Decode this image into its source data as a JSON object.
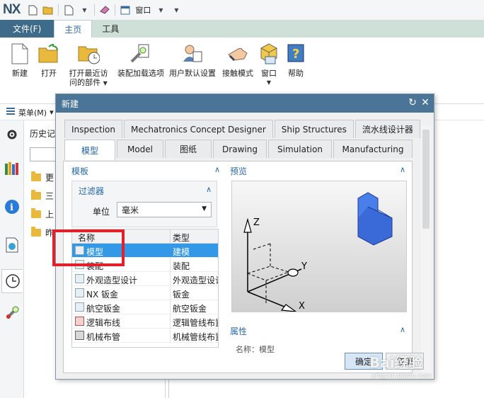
{
  "app": {
    "logo": "NX",
    "window_menu": "窗口"
  },
  "ribbon_tabs": [
    "文件(F)",
    "主页",
    "工具"
  ],
  "ribbon_buttons": [
    {
      "label": "新建",
      "label2": ""
    },
    {
      "label": "打开",
      "label2": ""
    },
    {
      "label": "打开最近访",
      "label2": "问的部件"
    },
    {
      "label": "装配加载选项",
      "label2": ""
    },
    {
      "label": "用户默认设置",
      "label2": ""
    },
    {
      "label": "接触模式",
      "label2": ""
    },
    {
      "label": "窗口",
      "label2": ""
    },
    {
      "label": "帮助",
      "label2": ""
    }
  ],
  "menu": {
    "label": "菜单(M)"
  },
  "history": {
    "title": "历史记",
    "folders": [
      "更",
      "三",
      "上",
      "昨"
    ]
  },
  "dialog": {
    "title": "新建",
    "tabs_row1": [
      "Inspection",
      "Mechatronics Concept Designer",
      "Ship Structures",
      "流水线设计器"
    ],
    "tabs_row2": [
      "模型",
      "Model",
      "图纸",
      "Drawing",
      "Simulation",
      "Manufacturing"
    ],
    "template_section": "模板",
    "filter_section": "过滤器",
    "unit_label": "单位",
    "unit_value": "毫米",
    "preview_section": "预览",
    "properties_section": "属性",
    "properties_partial": "名称：模型",
    "list_headers": {
      "name": "名称",
      "type": "类型"
    },
    "templates": [
      {
        "name": "模型",
        "type": "建模",
        "selected": true
      },
      {
        "name": "装配",
        "type": "装配",
        "selected": false
      },
      {
        "name": "外观造型设计",
        "type": "外观造型设计",
        "selected": false
      },
      {
        "name": "NX 钣金",
        "type": "钣金",
        "selected": false
      },
      {
        "name": "航空钣金",
        "type": "航空钣金",
        "selected": false
      },
      {
        "name": "逻辑布线",
        "type": "逻辑管线布置",
        "selected": false
      },
      {
        "name": "机械布管",
        "type": "机械管线布置",
        "selected": false
      }
    ],
    "ok": "确定",
    "cancel": "取消",
    "preview_axes": {
      "x": "X",
      "y": "Y",
      "z": "Z"
    }
  },
  "watermark": {
    "text": "Bai经验",
    "sub": "jingyan.baidu.com"
  },
  "colors": {
    "title_bar": "#4b7596",
    "selection": "#3399e6",
    "highlight_box": "#e3202a",
    "file_tab": "#3e6b8a"
  }
}
